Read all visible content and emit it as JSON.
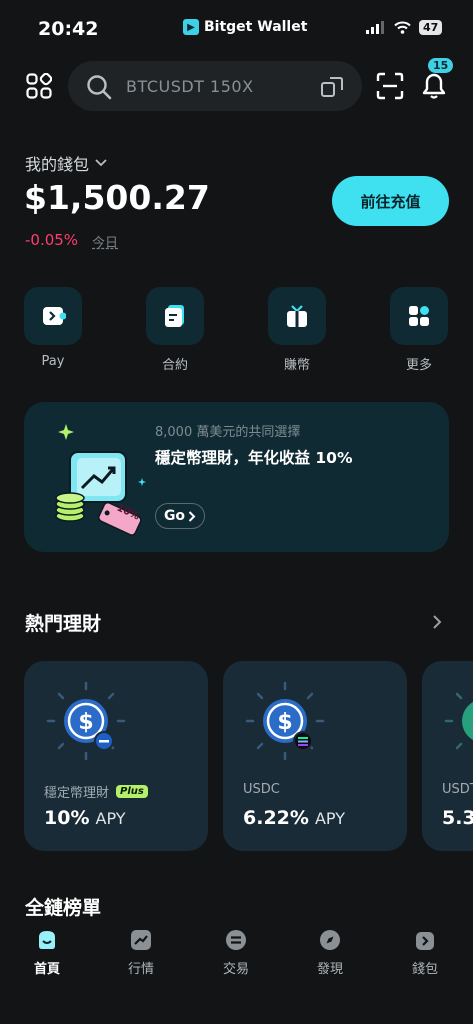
{
  "status": {
    "time": "20:42",
    "brand": "Bitget Wallet",
    "battery": "47"
  },
  "search": {
    "placeholder": "BTCUSDT 150X"
  },
  "notifications": {
    "count": "15"
  },
  "wallet": {
    "label": "我的錢包",
    "balance": "$1,500.27",
    "change": "-0.05%",
    "change_period": "今日",
    "deposit_label": "前往充值"
  },
  "quick_actions": [
    {
      "label": "Pay",
      "icon": "pay-icon"
    },
    {
      "label": "合約",
      "icon": "contract-icon"
    },
    {
      "label": "賺幣",
      "icon": "earn-gift-icon"
    },
    {
      "label": "更多",
      "icon": "more-grid-icon"
    }
  ],
  "promo": {
    "subtitle": "8,000 萬美元的共同選擇",
    "title": "穩定幣理財，年化收益 10%",
    "button": "Go",
    "tag": "10%"
  },
  "hot_section": {
    "title": "熱門理財"
  },
  "cards": [
    {
      "label": "穩定幣理財",
      "badge": "Plus",
      "rate": "10%",
      "unit": "APY"
    },
    {
      "label": "USDC",
      "badge": "",
      "rate": "6.22%",
      "unit": "APY"
    },
    {
      "label": "USDT",
      "badge": "",
      "rate": "5.3",
      "unit": ""
    }
  ],
  "chain_section": {
    "title": "全鏈榜單"
  },
  "nav": [
    {
      "label": "首頁",
      "active": true
    },
    {
      "label": "行情",
      "active": false
    },
    {
      "label": "交易",
      "active": false
    },
    {
      "label": "發現",
      "active": false
    },
    {
      "label": "錢包",
      "active": false
    }
  ],
  "colors": {
    "accent": "#3fe0f0",
    "negative": "#ff3e6c",
    "card": "#1a2b38",
    "promo": "#0f2a33",
    "plus_badge": "#b4f06a"
  }
}
